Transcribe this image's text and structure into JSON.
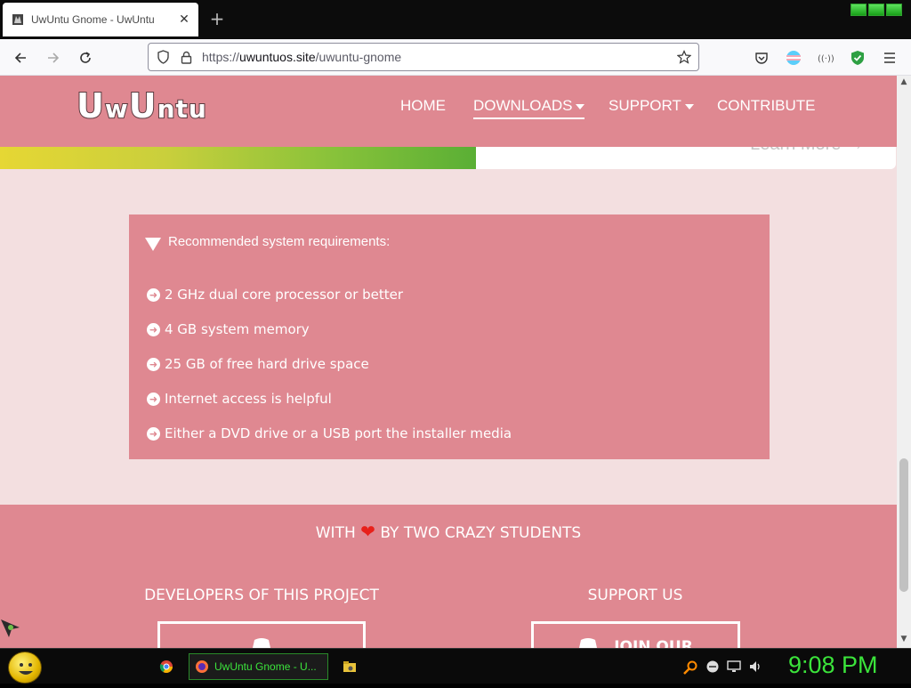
{
  "browser": {
    "tab": {
      "title": "UwUntu Gnome - UwUntu",
      "close": "✕"
    },
    "new_tab": "+",
    "url": {
      "scheme": "https://",
      "host": "uwuntuos.site",
      "path": "/uwuntu-gnome"
    }
  },
  "site": {
    "logo": {
      "part1": "U",
      "part2": "w",
      "part3": "U",
      "part4": "ntu"
    },
    "menu": [
      {
        "label": "HOME",
        "dropdown": false,
        "active": false
      },
      {
        "label": "DOWNLOADS",
        "dropdown": true,
        "active": true
      },
      {
        "label": "SUPPORT",
        "dropdown": true,
        "active": false
      },
      {
        "label": "CONTRIBUTE",
        "dropdown": false,
        "active": false
      }
    ],
    "learn_more": "Learn More →",
    "requirements": {
      "title": "Recommended system requirements:",
      "items": [
        "2 GHz dual core processor or better",
        "4 GB system memory",
        "25 GB of free hard drive space",
        "Internet access is helpful",
        "Either a DVD drive or a USB port the installer media"
      ]
    },
    "footer": {
      "made_with_prefix": "WITH",
      "heart": "❤",
      "made_with_suffix": "BY TWO CRAZY STUDENTS",
      "developers_title": "DEVELOPERS OF THIS PROJECT",
      "support_title": "SUPPORT US",
      "support_button": "JOIN OUR"
    }
  },
  "taskbar": {
    "task_label": "UwUntu Gnome - U...",
    "clock": "9:08 PM"
  },
  "colors": {
    "header_pink": "#df8891",
    "page_bg": "#f3dfe0",
    "clock_green": "#3be33b"
  }
}
